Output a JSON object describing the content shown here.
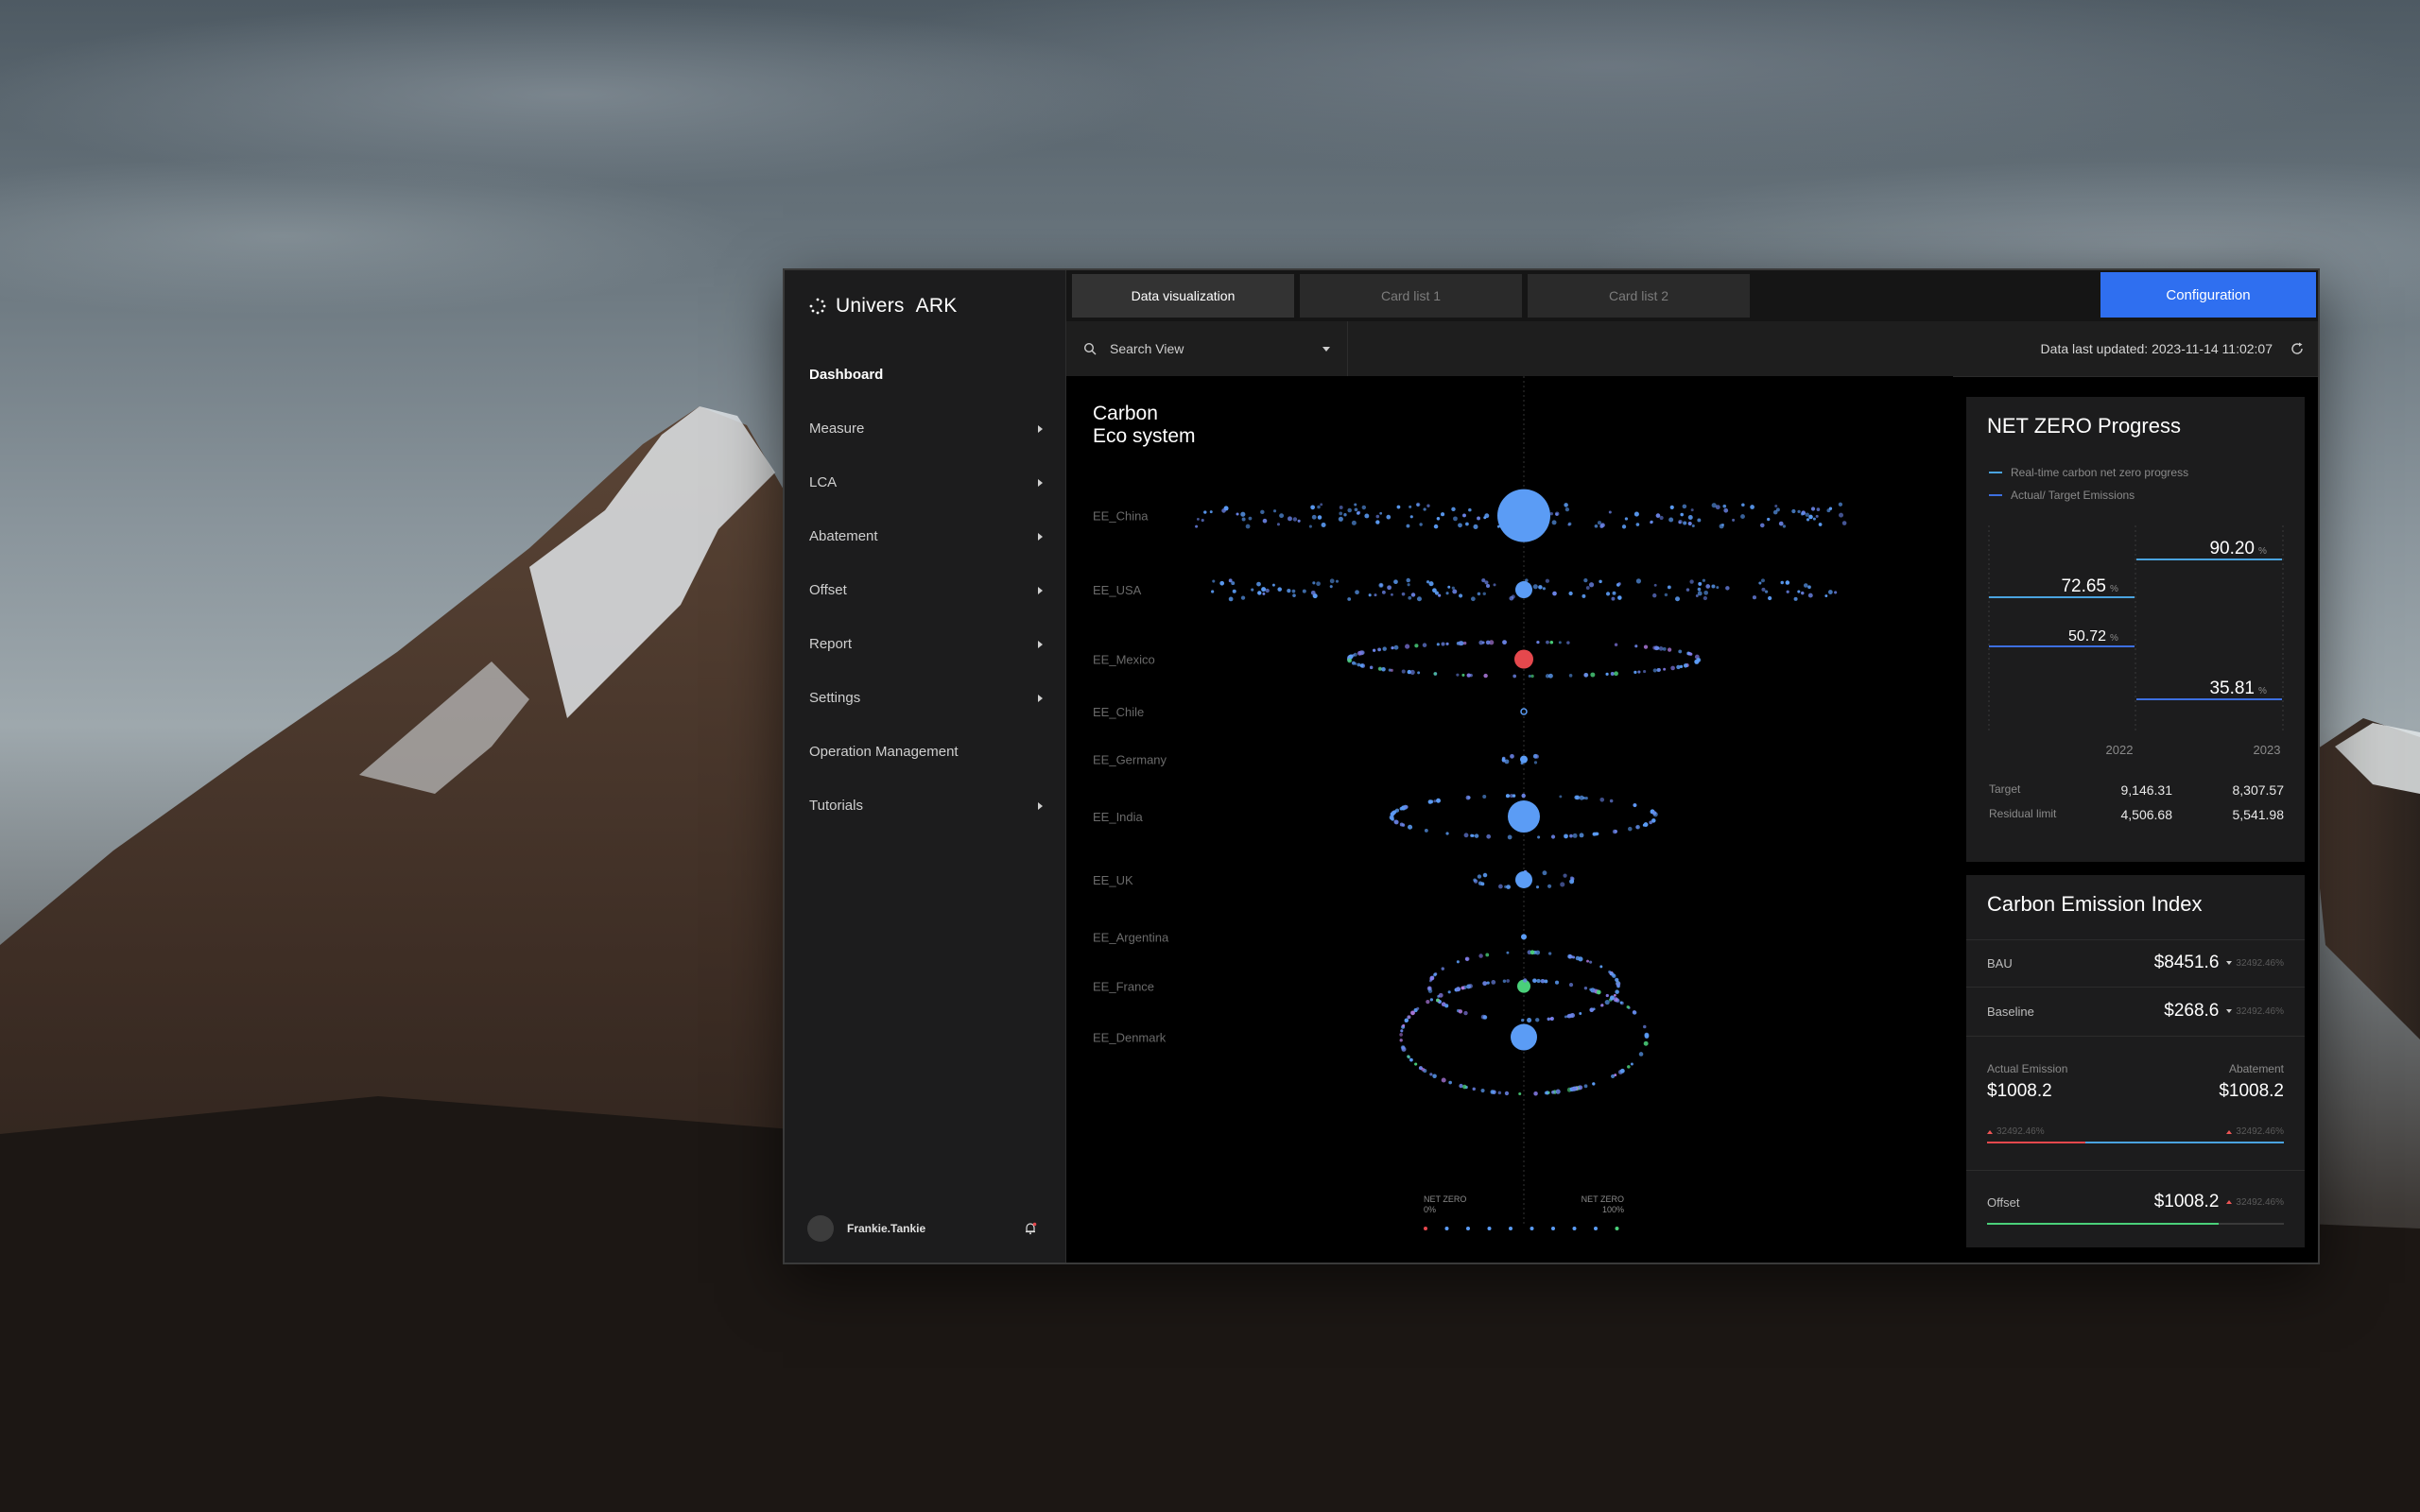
{
  "brand": {
    "name": "Univers",
    "product": "ARK"
  },
  "tabs": [
    {
      "label": "Data visualization",
      "active": true
    },
    {
      "label": "Card list 1",
      "active": false
    },
    {
      "label": "Card list 2",
      "active": false
    }
  ],
  "config_button": "Configuration",
  "search": {
    "label": "Search View"
  },
  "updated": "Data last updated: 2023-11-14 11:02:07",
  "sidebar": {
    "items": [
      {
        "label": "Dashboard",
        "active": true,
        "expandable": false
      },
      {
        "label": "Measure",
        "expandable": true
      },
      {
        "label": "LCA",
        "expandable": true
      },
      {
        "label": "Abatement",
        "expandable": true
      },
      {
        "label": "Offset",
        "expandable": true
      },
      {
        "label": "Report",
        "expandable": true
      },
      {
        "label": "Settings",
        "expandable": true
      },
      {
        "label": "Operation Management",
        "expandable": false
      },
      {
        "label": "Tutorials",
        "expandable": true
      }
    ],
    "user": "Frankie.Tankie"
  },
  "viz": {
    "title_line1": "Carbon",
    "title_line2": "Eco system",
    "rows": [
      "EE_China",
      "EE_USA",
      "EE_Mexico",
      "EE_Chile",
      "EE_Germany",
      "EE_India",
      "EE_UK",
      "EE_Argentina",
      "EE_France",
      "EE_Denmark"
    ],
    "scale_left": "NET ZERO\n0%",
    "scale_right": "NET ZERO\n100%",
    "scale_left_l1": "NET ZERO",
    "scale_left_l2": "0%",
    "scale_right_l1": "NET ZERO",
    "scale_right_l2": "100%"
  },
  "net_zero": {
    "title": "NET ZERO Progress",
    "legend": [
      "Real-time carbon net zero progress",
      "Actual/ Target Emissions"
    ],
    "years": [
      "2022",
      "2023"
    ],
    "values_2022": [
      "72.65",
      "50.72"
    ],
    "values_2023": [
      "90.20",
      "35.81"
    ],
    "pct": "%",
    "table": [
      {
        "label": "Target",
        "v2022": "9,146.31",
        "v2023": "8,307.57"
      },
      {
        "label": "Residual limit",
        "v2022": "4,506.68",
        "v2023": "5,541.98"
      }
    ],
    "colors": {
      "line_a": "#4aa3df",
      "line_b": "#3d6fe0"
    }
  },
  "cei": {
    "title": "Carbon Emission Index",
    "bau": {
      "label": "BAU",
      "value": "$8451.6",
      "change": "32492.46%"
    },
    "baseline": {
      "label": "Baseline",
      "value": "$268.6",
      "change": "32492.46%"
    },
    "actual": {
      "label": "Actual Emission",
      "value": "$1008.2",
      "change": "32492.46%"
    },
    "abatement": {
      "label": "Abatement",
      "value": "$1008.2",
      "change": "32492.46%"
    },
    "offset": {
      "label": "Offset",
      "value": "$1008.2",
      "change": "32492.46%"
    },
    "progress": {
      "actual": 0.33,
      "offset": 0.78
    }
  }
}
